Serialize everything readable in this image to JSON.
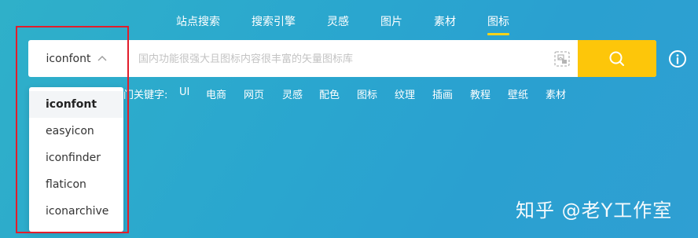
{
  "nav": {
    "items": [
      {
        "label": "站点搜索"
      },
      {
        "label": "搜索引擎"
      },
      {
        "label": "灵感"
      },
      {
        "label": "图片"
      },
      {
        "label": "素材"
      },
      {
        "label": "图标"
      }
    ],
    "active_index": 5
  },
  "search": {
    "engine_selected": "iconfont",
    "placeholder": "国内功能很强大且图标内容很丰富的矢量图标库",
    "value": ""
  },
  "keywords": {
    "label": "热门关键字:",
    "items": [
      "UI",
      "电商",
      "网页",
      "灵感",
      "配色",
      "图标",
      "纹理",
      "插画",
      "教程",
      "壁纸",
      "素材"
    ]
  },
  "dropdown": {
    "options": [
      "iconfont",
      "easyicon",
      "iconfinder",
      "flaticon",
      "iconarchive"
    ],
    "selected_index": 0
  },
  "watermark": "知乎 @老Y工作室",
  "colors": {
    "accent_yellow": "#fdc60a",
    "highlight_red": "#e21d2b",
    "nav_underline": "#f7d21a"
  },
  "icons": {
    "chevron": "chevron-up-icon",
    "image_search": "image-search-icon",
    "search": "search-icon",
    "info": "info-icon"
  }
}
